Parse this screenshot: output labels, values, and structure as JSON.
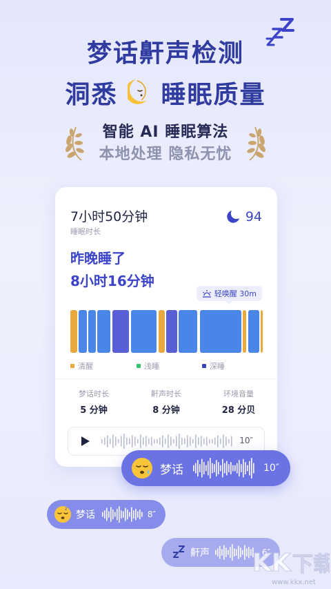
{
  "hero": {
    "line1": "梦话鼾声检测",
    "line2_left": "洞悉",
    "line2_right": "睡眠质量",
    "sub1": "智能 AI 睡眠算法",
    "sub2": "本地处理 隐私无忧"
  },
  "card": {
    "duration": "7小时50分钟",
    "duration_label": "睡眠时长",
    "score": "94",
    "slept_line1": "昨晚睡了",
    "slept_line2": "8小时16分钟",
    "wake_tag": "轻唤醒 30m",
    "legend": [
      {
        "label": "清醒",
        "color": "#e9a93e"
      },
      {
        "label": "浅睡",
        "color": "#35c46e"
      },
      {
        "label": "深睡",
        "color": "#3c44c4"
      }
    ],
    "stats": [
      {
        "key": "梦话时长",
        "value": "5 分钟"
      },
      {
        "key": "鼾声时长",
        "value": "8 分钟"
      },
      {
        "key": "环境音量",
        "value": "28 分贝"
      }
    ],
    "player_length": "10″"
  },
  "bubbles": [
    {
      "label": "梦话",
      "length": "10″",
      "icon": "sleepy-face-emoji"
    },
    {
      "label": "梦话",
      "length": "8″",
      "icon": "sleeping-face-emoji"
    },
    {
      "label": "鼾声",
      "length": "6″",
      "icon": "zzz-icon"
    }
  ],
  "watermark": {
    "text": "www.kkx.net"
  },
  "colors": {
    "accent": "#3b44c8",
    "awake": "#e9a93e",
    "light": "#4a86e8",
    "deep": "#5a5fd6"
  }
}
